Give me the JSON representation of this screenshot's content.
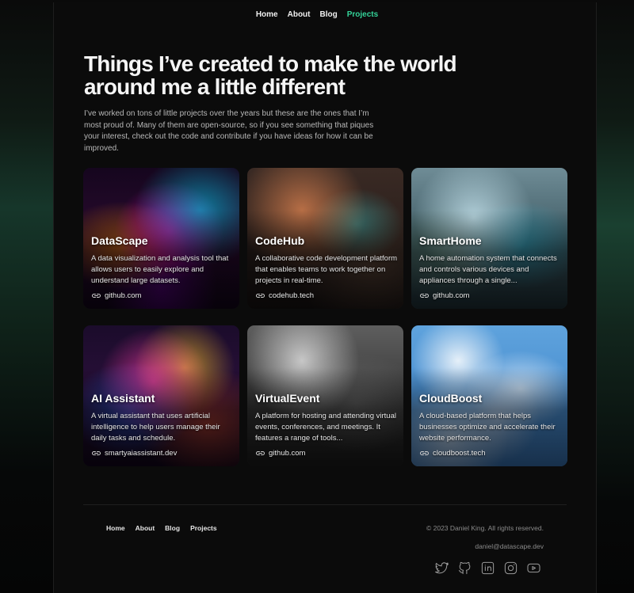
{
  "nav": {
    "items": [
      {
        "label": "Home"
      },
      {
        "label": "About"
      },
      {
        "label": "Blog"
      },
      {
        "label": "Projects",
        "active": true
      }
    ],
    "active_color": "#34d399"
  },
  "hero": {
    "title": "Things I’ve created to make the world around me a little different",
    "description": "I’ve worked on tons of little projects over the years but these are the ones that I’m most proud of. Many of them are open-source, so if you see something that piques your interest, check out the code and contribute if you have ideas for how it can be improved."
  },
  "projects": [
    {
      "title": "DataScape",
      "description": "A data visualization and analysis tool that allows users to easily explore and understand large datasets.",
      "link": "github.com",
      "art": "neon-data-waves"
    },
    {
      "title": "CodeHub",
      "description": "A collaborative code development platform that enables teams to work together on projects in real-time.",
      "link": "codehub.tech",
      "art": "retro-office-room"
    },
    {
      "title": "SmartHome",
      "description": "A home automation system that connects and controls various devices and appliances through a single...",
      "link": "github.com",
      "art": "futuristic-living-room"
    },
    {
      "title": "AI Assistant",
      "description": "A virtual assistant that uses artificial intelligence to help users manage their daily tasks and schedule.",
      "link": "smartyaiassistant.dev",
      "art": "neon-portrait"
    },
    {
      "title": "VirtualEvent",
      "description": "A platform for hosting and attending virtual events, conferences, and meetings. It features a range of tools...",
      "link": "github.com",
      "art": "vr-headset-crowd"
    },
    {
      "title": "CloudBoost",
      "description": "A cloud-based platform that helps businesses optimize and accelerate their website performance.",
      "link": "cloudboost.tech",
      "art": "airship-in-clouds"
    }
  ],
  "footer": {
    "nav": [
      {
        "label": "Home"
      },
      {
        "label": "About"
      },
      {
        "label": "Blog"
      },
      {
        "label": "Projects"
      }
    ],
    "copyright": "© 2023 Daniel King. All rights reserved.",
    "email": "daniel@datascape.dev",
    "socials": [
      "twitter-icon",
      "github-icon",
      "linkedin-icon",
      "instagram-icon",
      "youtube-icon"
    ]
  }
}
